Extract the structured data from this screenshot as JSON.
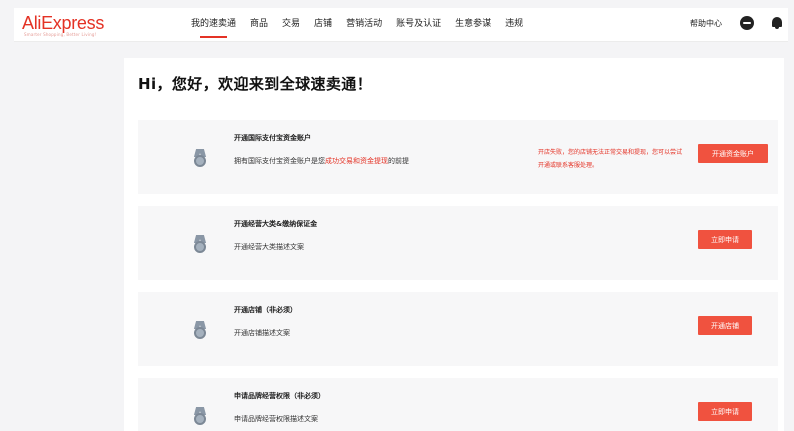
{
  "header": {
    "logo": "AliExpress",
    "logo_sub": "Smarter Shopping, Better Living!",
    "nav": [
      "我的速卖通",
      "商品",
      "交易",
      "店铺",
      "营销活动",
      "账号及认证",
      "生意参谋",
      "违规"
    ],
    "active_nav": 0,
    "help": "帮助中心",
    "icons": [
      "chat-icon",
      "bell-icon"
    ]
  },
  "main": {
    "welcome": "Hi，您好，欢迎来到全球速卖通！",
    "tasks": [
      {
        "title": "开通国际支付宝资金账户",
        "desc_before": "拥有国际支付宝资金账户是您",
        "desc_highlight": "成功交易和资金提现",
        "desc_after": "的前提",
        "warning": "开店失败，您的店铺无法正常交易和提现，您可以尝试开通或联系客服处理。",
        "button": "开通资金账户"
      },
      {
        "title": "开通经营大类&缴纳保证金",
        "desc": "开通经营大类描述文案",
        "button": "立即申请"
      },
      {
        "title": "开通店铺（非必须）",
        "desc": "开通店铺描述文案",
        "button": "开通店铺"
      },
      {
        "title": "申请品牌经营权限（非必须）",
        "desc": "申请品牌经营权限描述文案",
        "button": "立即申请"
      }
    ]
  },
  "colors": {
    "accent": "#e43225",
    "button": "#f0523f",
    "background": "#f4f4f6",
    "card": "#f7f7f8"
  }
}
